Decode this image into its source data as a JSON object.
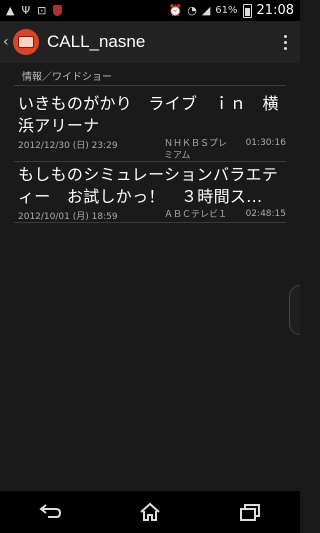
{
  "status_bar": {
    "battery_percent": "61%",
    "time": "21:08"
  },
  "app": {
    "title": "CALL_nasne"
  },
  "section": {
    "header": "情報／ワイドショー"
  },
  "items": [
    {
      "title": "いきものがかり　ライブ　ｉｎ　横浜アリーナ",
      "date": "2012/12/30 (日) 23:29",
      "channel": "ＮＨＫＢＳプレミアム",
      "duration": "01:30:16"
    },
    {
      "title": "もしものシミュレーションバラエティー　お試しかっ！　３時間ス...",
      "date": "2012/10/01 (月) 18:59",
      "channel": "ＡＢＣテレビ１",
      "duration": "02:48:15"
    }
  ],
  "icons": {
    "up": "chevron-left-icon",
    "app": "app-logo-icon",
    "overflow": "overflow-menu-icon",
    "back": "back-icon",
    "home": "home-icon",
    "recent": "recent-apps-icon"
  },
  "colors": {
    "background": "#1a1a1a",
    "app_icon": "#d9452a",
    "text": "#ffffff",
    "secondary_text": "#aaaaaa"
  }
}
